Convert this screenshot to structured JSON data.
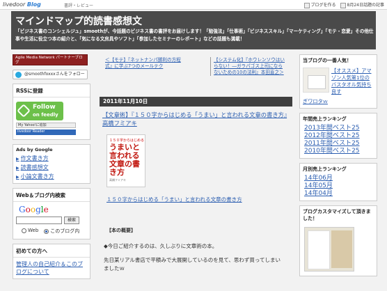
{
  "topbar": {
    "logo": "livedoor",
    "logo_blog": "Blog",
    "sub": "書評・レビュー",
    "bookmark": "ブログを作る",
    "notify": "8月24日話題の記事"
  },
  "header": {
    "title": "マインドマップ的読書感想文",
    "desc": "「ビジネス書のコンシェルジュ」smoothが、今話題のビジネス書の書評をお届けします！「勉強法」「仕事術」「ビジネススキル」「マーケティング」「モテ・恋愛」その他仕事や生活に役立つ本の紹介と、「気になる文房具やソフト」「参加したセミナーのレポート」などの話題も満載！"
  },
  "left": {
    "banner": "Agile Media Network パートナーブログ",
    "twitter": "@smoothfoxxxさんをフォロー",
    "rss_heading": "RSSに登録",
    "feedly_follow": "Follow",
    "feedly_on": "on feedly",
    "rss_btn1": "My Yahoo!に追加",
    "rss_btn2": "livedoor Reader",
    "ads_heading": "Ads by Google",
    "ads": [
      "作文書き方",
      "読書感想文",
      "小論文書き方"
    ],
    "search_heading": "Web＆ブログ内検索",
    "search_btn": "検索",
    "radio_web": "Web",
    "radio_blog": "このブログ内",
    "beginners_heading": "初めての方へ",
    "beginners_link": "管理人の自己紹介＆このブログについて"
  },
  "main": {
    "prev_link": "＜【モテ】『ネットナンパ勝利の方程式』に学ぶ7つのメールテク",
    "next_link": "【システム化】『ホウレンソウはいらない！―ガラパゴス上司にならないための10の法則』本田直之＞",
    "date": "2011年11月10日",
    "post_title": "【文章術】『１５０字からはじめる「うまい」と言われる文章の書き方』高橋フミアキ",
    "book_small": "１５０字からはじめる",
    "book_title": "うまいと言われる文章の書き方",
    "book_author": "高橋フミアキ",
    "book_link": "１５０字からはじめる「うまい」と言われる文章の書き方",
    "section_heading": "【本の概要】",
    "body1": "◆今日ご紹介するのは、久しぶりに文章術の本。",
    "body2": "先日某リアル書店で平積みで大展開しているのを見て、思わず買ってしまいましたｗ"
  },
  "right": {
    "recommend_heading": "当ブログの一番人気！",
    "recommend_text": "【オススメ】アマゾン人気第1位のバスタオル気持ち良すぎワロタｗ",
    "yearly_heading": "年間売上ランキング",
    "yearly": [
      "2013年間ベスト25",
      "2012年間ベスト25",
      "2011年間ベスト25",
      "2010年間ベスト25"
    ],
    "monthly_heading": "月別売上ランキング",
    "monthly": [
      "14年06月",
      "14年05月",
      "14年04月"
    ],
    "custom_heading": "ブログカスタマイズして頂きました！"
  }
}
